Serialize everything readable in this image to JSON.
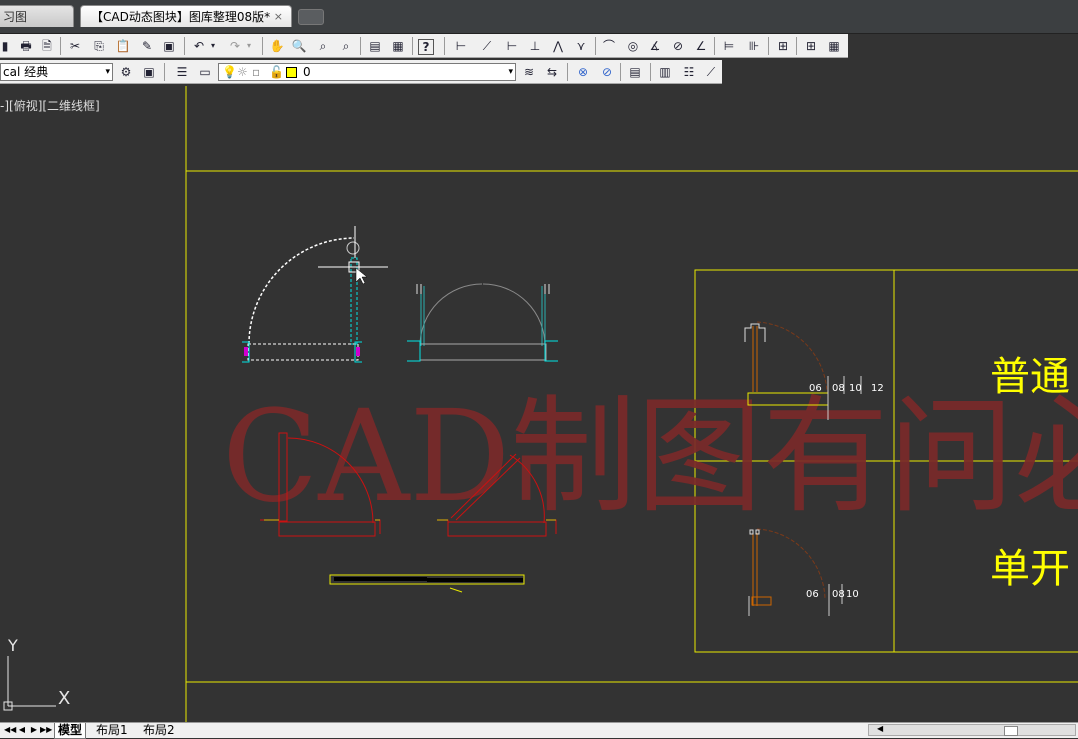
{
  "doc_tabs": [
    {
      "label": "习图"
    },
    {
      "label": "【CAD动态图块】图库整理08版*",
      "close": "×"
    }
  ],
  "layer_combo": {
    "value": "cal 经典",
    "arrow": "▾"
  },
  "layer_state_combo": {
    "value": "0",
    "arrow": "▾"
  },
  "viewport_label": "-][俯视][二维线框]",
  "drawing": {
    "watermark": "CAD制图有问必",
    "big_labels": [
      "普通",
      "单开"
    ],
    "dims_upper": [
      "06",
      "08",
      "10",
      "12"
    ],
    "dims_lower": [
      "06",
      "08",
      "10"
    ]
  },
  "ucs": {
    "x": "X",
    "y": "Y"
  },
  "layout_tabs": [
    "模型",
    "布局1",
    "布局2"
  ],
  "nav_arrows": [
    "◀◀",
    "◀",
    "▶",
    "▶▶"
  ],
  "colors": {
    "canvas": "#333333",
    "frame_yellow": "#e8e800",
    "watermark_red": "#7a2a2a",
    "door_red": "#cc1111",
    "cyan": "#00e5e5"
  },
  "toolbar_icons": {
    "row1": [
      "print-icon",
      "print-preview-icon",
      "cut-icon",
      "copy-icon",
      "paste-icon",
      "match-properties-icon",
      "undo-icon",
      "redo-icon",
      "pan-icon",
      "zoom-realtime-icon",
      "zoom-window-icon",
      "zoom-previous-icon",
      "properties-icon",
      "calculator-icon",
      "help-icon",
      "dim-linear-icon",
      "dim-aligned-icon",
      "dim-arc-icon",
      "dim-ordinate-icon",
      "dim-radius-icon",
      "dim-jogged-icon",
      "dim-diameter-icon",
      "dim-angular-icon",
      "quick-dim-icon",
      "dim-baseline-icon",
      "dim-continue-icon",
      "dim-space-icon",
      "dim-break-icon",
      "tolerance-icon",
      "center-mark-icon",
      "dim-inspect-icon",
      "dim-jogged-linear-icon",
      "dim-edit-icon"
    ],
    "row2": [
      "workspace-settings-icon",
      "toolbar-lock-icon",
      "layer-properties-icon",
      "layer-state-icon",
      "layer-previous-icon",
      "isolate-icon",
      "unisolate-icon",
      "match-layer-icon",
      "layer-walk-icon",
      "layer-freeze-icon",
      "layer-off-icon",
      "layer-lock-icon"
    ]
  }
}
